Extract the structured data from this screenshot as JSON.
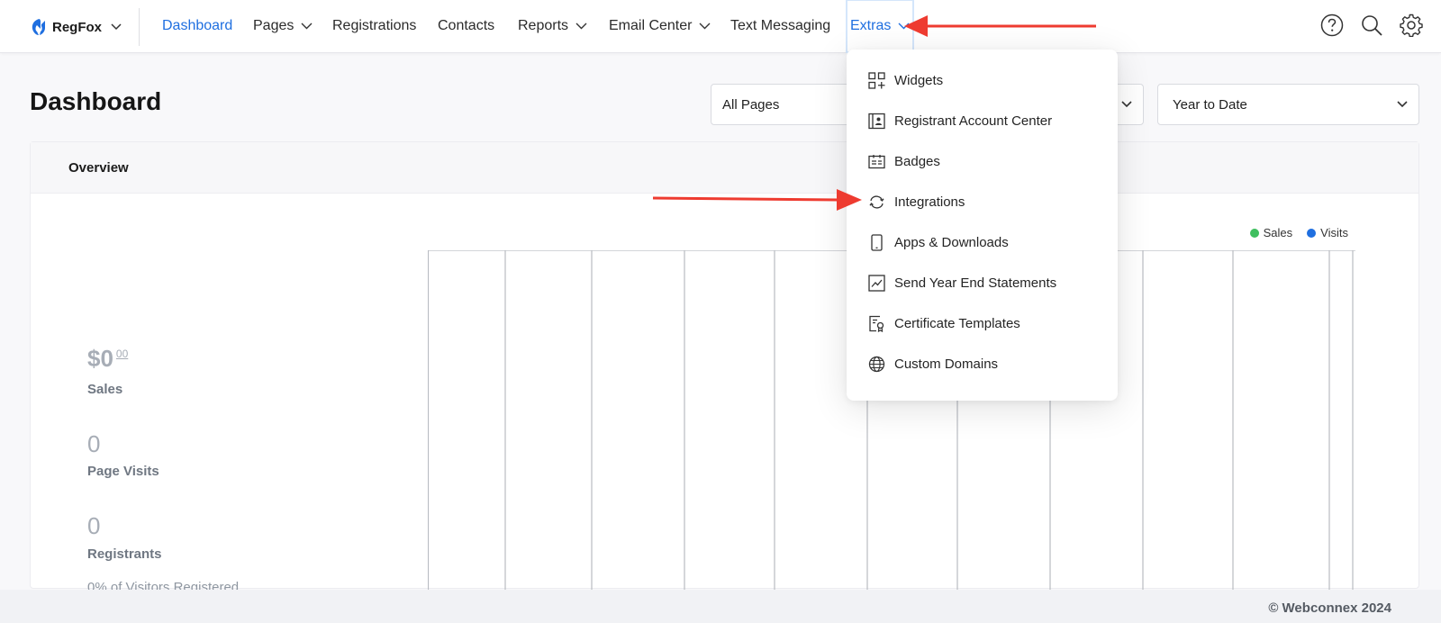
{
  "brand": {
    "name": "RegFox"
  },
  "nav": {
    "items": [
      {
        "label": "Dashboard",
        "active": true,
        "has_menu": false
      },
      {
        "label": "Pages",
        "has_menu": true
      },
      {
        "label": "Registrations",
        "has_menu": false
      },
      {
        "label": "Contacts",
        "has_menu": false
      },
      {
        "label": "Reports",
        "has_menu": true
      },
      {
        "label": "Email Center",
        "has_menu": true
      },
      {
        "label": "Text Messaging",
        "has_menu": false
      },
      {
        "label": "Extras",
        "has_menu": true,
        "open": true
      }
    ],
    "right_icons": [
      "help-icon",
      "search-icon",
      "gear-icon"
    ]
  },
  "page": {
    "title": "Dashboard",
    "pages_select": "All Pages",
    "range_select": "Year to Date"
  },
  "overview": {
    "header": "Overview",
    "sales": {
      "value": "$0",
      "cents": "00",
      "label": "Sales"
    },
    "visits": {
      "value": "0",
      "label": "Page Visits"
    },
    "registrants": {
      "value": "0",
      "label": "Registrants",
      "sub": "0% of Visitors Registered"
    },
    "legend": [
      {
        "name": "Sales",
        "color": "#3fbf5f"
      },
      {
        "name": "Visits",
        "color": "#1f6fe0"
      }
    ]
  },
  "extras_menu": {
    "items": [
      {
        "label": "Widgets",
        "icon": "widgets-icon"
      },
      {
        "label": "Registrant Account Center",
        "icon": "account-center-icon"
      },
      {
        "label": "Badges",
        "icon": "badge-icon"
      },
      {
        "label": "Integrations",
        "icon": "integrations-icon"
      },
      {
        "label": "Apps & Downloads",
        "icon": "mobile-icon"
      },
      {
        "label": "Send Year End Statements",
        "icon": "chart-line-icon"
      },
      {
        "label": "Certificate Templates",
        "icon": "certificate-icon"
      },
      {
        "label": "Custom Domains",
        "icon": "globe-icon"
      }
    ]
  },
  "footer": {
    "text": "© Webconnex 2024"
  },
  "colors": {
    "accent": "#1f6fe0",
    "annotation": "#ee3b30"
  }
}
